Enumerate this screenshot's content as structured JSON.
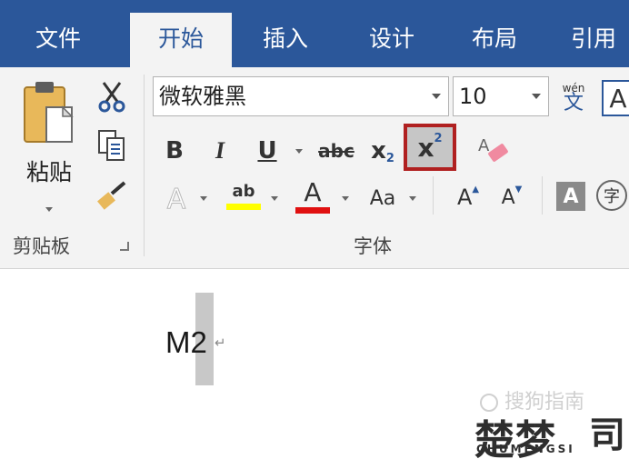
{
  "tabs": [
    {
      "label": "文件",
      "active": false
    },
    {
      "label": "开始",
      "active": true
    },
    {
      "label": "插入",
      "active": false
    },
    {
      "label": "设计",
      "active": false
    },
    {
      "label": "布局",
      "active": false
    },
    {
      "label": "引用",
      "active": false
    }
  ],
  "clipboard": {
    "paste_label": "粘贴",
    "group_label": "剪贴板"
  },
  "font": {
    "font_name": "微软雅黑",
    "font_size": "10",
    "group_label": "字体",
    "phonetic_top": "wén",
    "phonetic_bottom": "文",
    "bold": "B",
    "italic": "I",
    "underline": "U",
    "strikethrough": "abc",
    "subscript_base": "x",
    "subscript_mark": "2",
    "superscript_base": "x",
    "superscript_mark": "2",
    "text_effects": "A",
    "highlight_mark": "ab",
    "font_color": "A",
    "change_case": "Aa",
    "grow_font": "A",
    "shrink_font": "A",
    "char_shading": "A",
    "enclose_char": "字",
    "style_box": "A"
  },
  "colors": {
    "tab_bar": "#2b579a",
    "ribbon_bg": "#f3f3f3",
    "highlight_yellow": "#ffff00",
    "font_red": "#e01010",
    "superscript_border": "#b02020"
  },
  "document": {
    "text": "M2",
    "paragraph_mark": "↵"
  },
  "watermark": {
    "brand": "搜狗指南",
    "logo": "楚梦",
    "logo_sub": "CHUMENGSI"
  }
}
